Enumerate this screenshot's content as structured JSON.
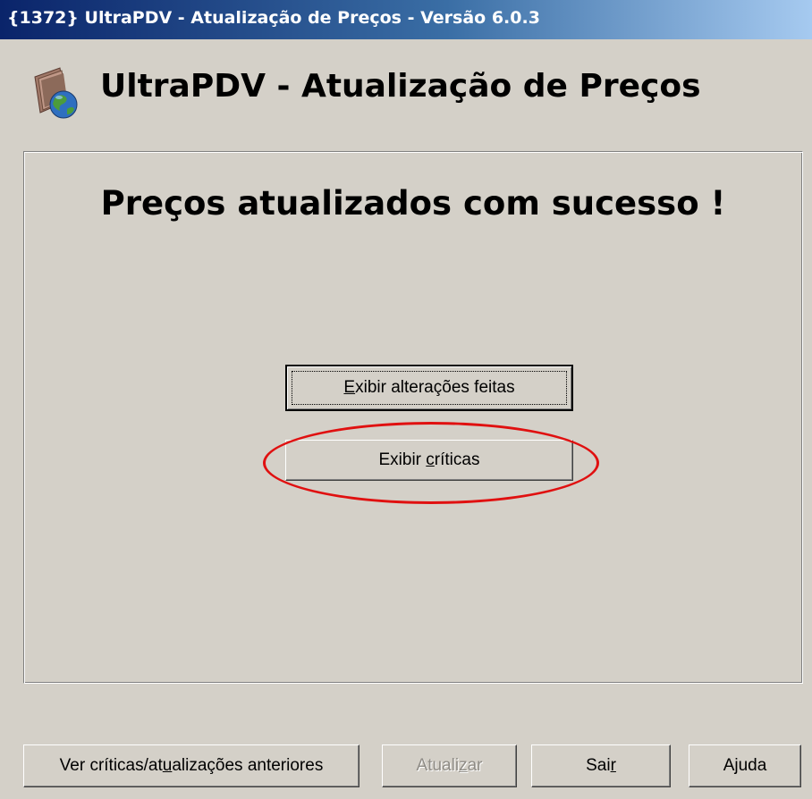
{
  "window": {
    "title": "{1372} UltraPDV - Atualização de Preços - Versão 6.0.3"
  },
  "header": {
    "app_title": "UltraPDV - Atualização de Preços",
    "icon": "app-book-globe-icon"
  },
  "main": {
    "message": "Preços atualizados com sucesso !",
    "exibir_alteracoes": {
      "before": "",
      "underlined": "E",
      "after": "xibir alterações feitas"
    },
    "exibir_criticas": {
      "before": "Exibir ",
      "underlined": "c",
      "after": "ríticas"
    },
    "annotation_color": "#e01010"
  },
  "footer": {
    "ver_criticas": {
      "before": "Ver críticas/at",
      "underlined": "u",
      "after": "alizações anteriores"
    },
    "atualizar": {
      "before": "Atuali",
      "underlined": "z",
      "after": "ar",
      "disabled": true
    },
    "sair": {
      "before": "Sai",
      "underlined": "r",
      "after": ""
    },
    "ajuda": {
      "before": "Ajuda",
      "underlined": "",
      "after": ""
    }
  },
  "colors": {
    "window_bg": "#d4d0c8",
    "titlebar_start": "#0a246a",
    "titlebar_end": "#a6caf0"
  }
}
